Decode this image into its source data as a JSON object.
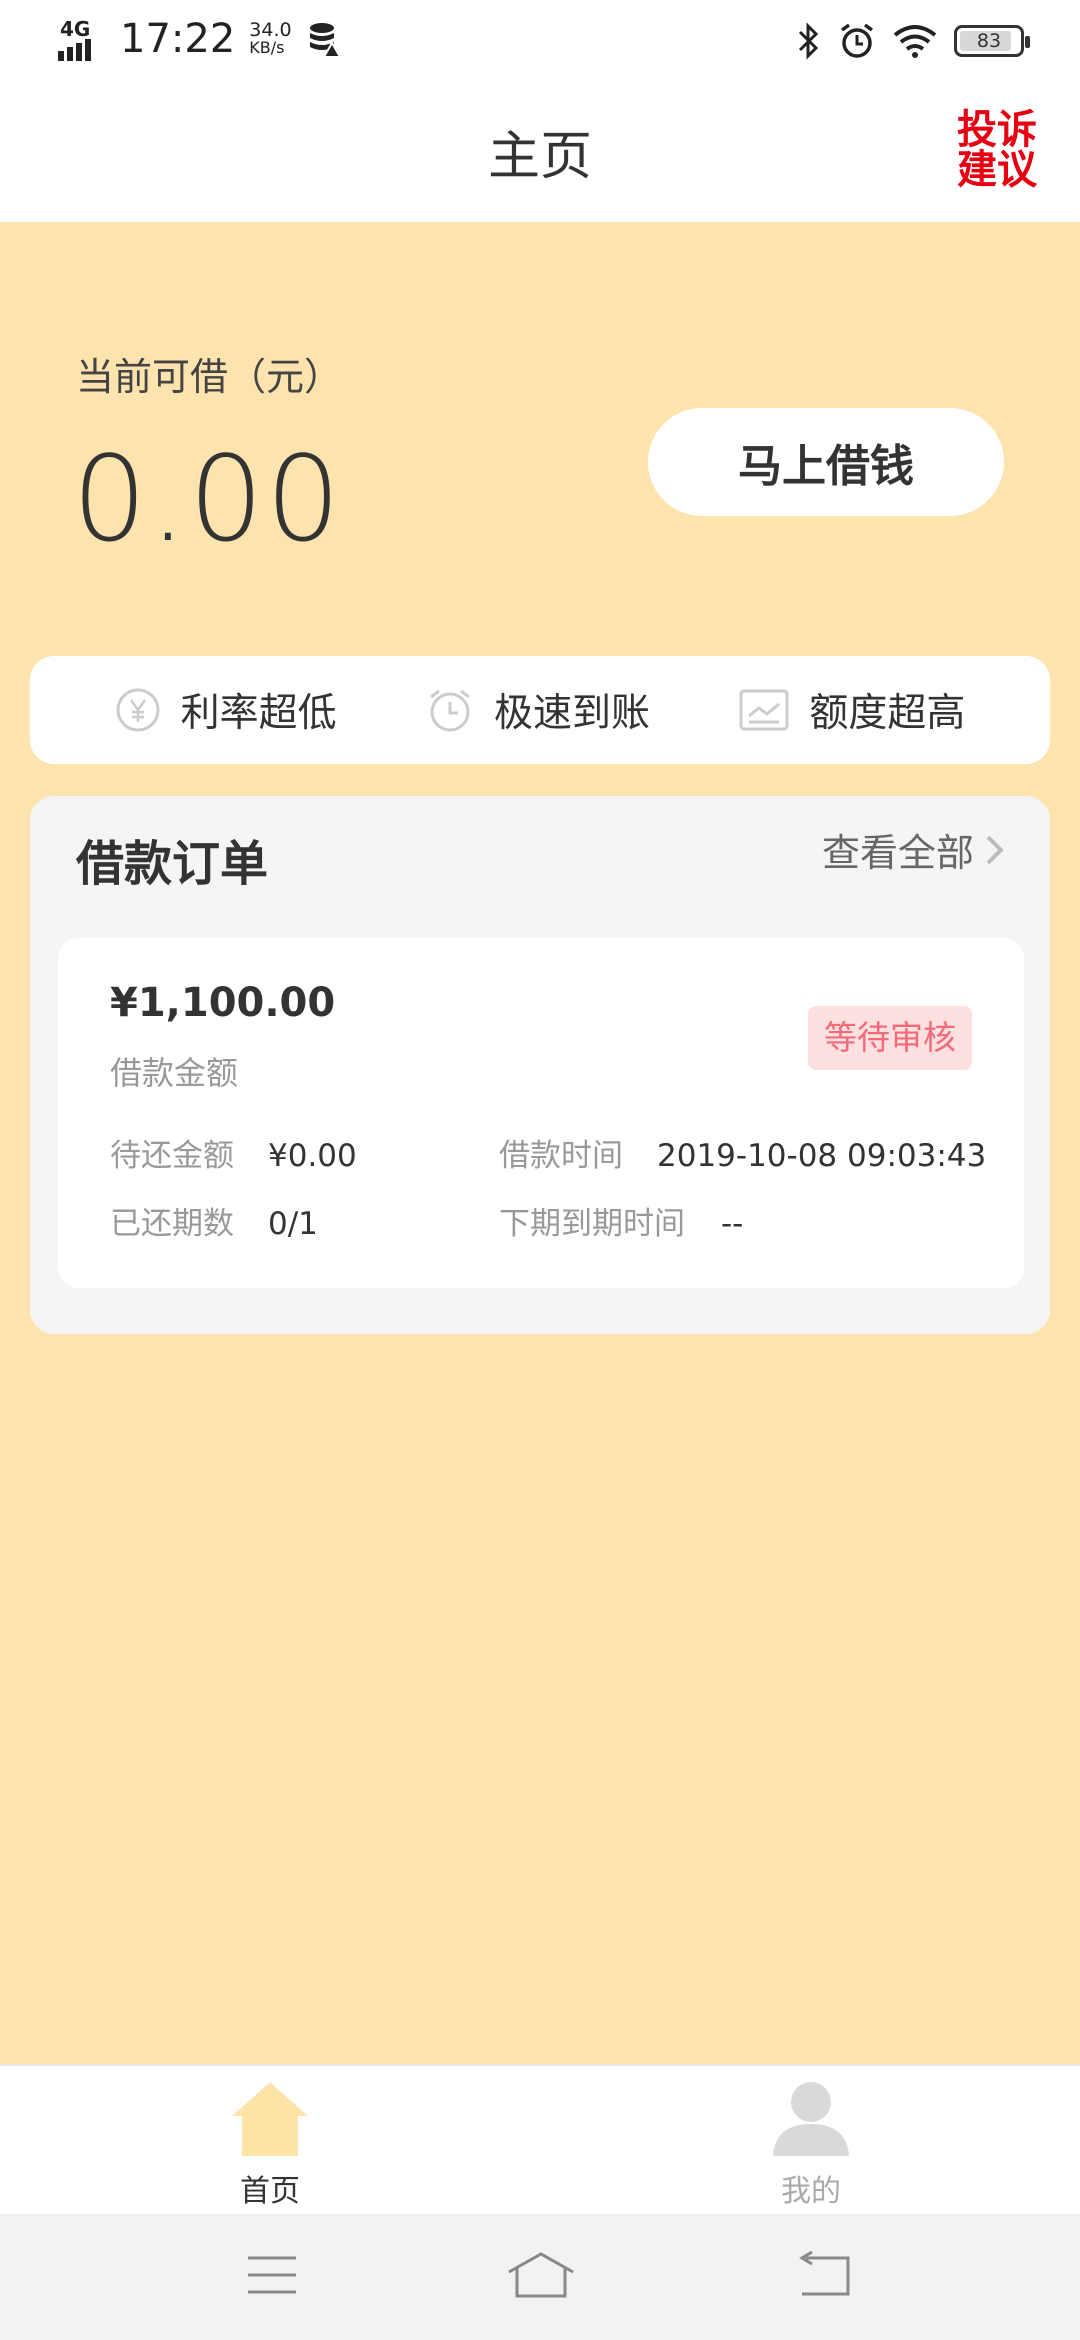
{
  "status_bar": {
    "network": "4G",
    "time": "17:22",
    "speed_value": "34.0",
    "speed_unit": "KB/s",
    "battery": "83",
    "icons": [
      "data-saver-icon",
      "bluetooth-icon",
      "alarm-icon",
      "wifi-icon"
    ]
  },
  "header": {
    "title": "主页",
    "complaint_label": "投诉建议"
  },
  "hero": {
    "available_label": "当前可借（元）",
    "available_amount": "0.00",
    "borrow_button": "马上借钱"
  },
  "features": [
    {
      "label": "利率超低",
      "icon": "yen-coin-icon"
    },
    {
      "label": "极速到账",
      "icon": "clock-icon"
    },
    {
      "label": "额度超高",
      "icon": "chart-up-icon"
    }
  ],
  "orders": {
    "title": "借款订单",
    "view_all": "查看全部",
    "items": [
      {
        "amount": "¥1,100.00",
        "amount_label": "借款金额",
        "status": "等待审核",
        "pending_label": "待还金额",
        "pending_value": "¥0.00",
        "loan_time_label": "借款时间",
        "loan_time_value": "2019-10-08 09:03:43",
        "repaid_label": "已还期数",
        "repaid_value": "0/1",
        "next_due_label": "下期到期时间",
        "next_due_value": "--"
      }
    ]
  },
  "bottom_nav": [
    {
      "label": "首页",
      "icon": "home-icon",
      "active": true
    },
    {
      "label": "我的",
      "icon": "user-icon",
      "active": false
    }
  ],
  "system_nav": [
    "menu-icon",
    "home-outline-icon",
    "back-icon"
  ],
  "colors": {
    "background": "#fde4ae",
    "accent_red": "#e60012",
    "status_badge_bg": "#fde0e0",
    "status_badge_text": "#f36a7a",
    "home_icon": "#fde4ae"
  }
}
